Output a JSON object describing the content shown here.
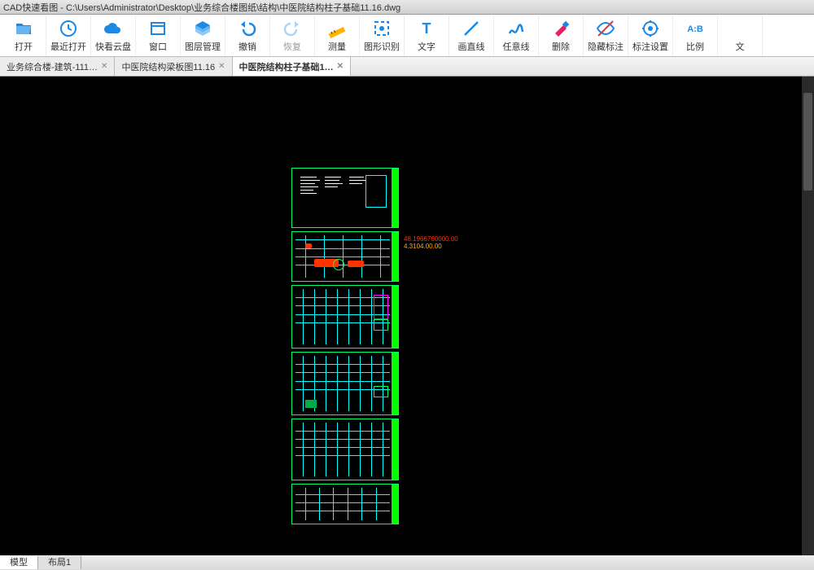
{
  "title": "CAD快速看图 - C:\\Users\\Administrator\\Desktop\\业务综合楼图纸\\结构\\中医院结构柱子基础11.16.dwg",
  "toolbar": [
    {
      "id": "open",
      "label": "打开"
    },
    {
      "id": "recent",
      "label": "最近打开"
    },
    {
      "id": "cloud",
      "label": "快看云盘"
    },
    {
      "id": "window",
      "label": "窗口"
    },
    {
      "id": "layers",
      "label": "图层管理"
    },
    {
      "id": "undo",
      "label": "撤销"
    },
    {
      "id": "redo",
      "label": "恢复"
    },
    {
      "id": "measure",
      "label": "测量"
    },
    {
      "id": "recognize",
      "label": "图形识别"
    },
    {
      "id": "text",
      "label": "文字"
    },
    {
      "id": "line",
      "label": "画直线"
    },
    {
      "id": "polyline",
      "label": "任意线"
    },
    {
      "id": "delete",
      "label": "删除"
    },
    {
      "id": "hide",
      "label": "隐藏标注"
    },
    {
      "id": "annoset",
      "label": "标注设置"
    },
    {
      "id": "scale",
      "label": "比例"
    },
    {
      "id": "more",
      "label": "文"
    }
  ],
  "tabs": [
    {
      "label": "业务综合楼-建筑-111…",
      "active": false
    },
    {
      "label": "中医院结构梁板图11.16",
      "active": false
    },
    {
      "label": "中医院结构柱子基础1…",
      "active": true
    }
  ],
  "dims": {
    "a": "48.1966760000.00",
    "b": "4.3104.00.00"
  },
  "bottomTabs": [
    {
      "label": "模型",
      "active": true
    },
    {
      "label": "布局1",
      "active": false
    }
  ]
}
